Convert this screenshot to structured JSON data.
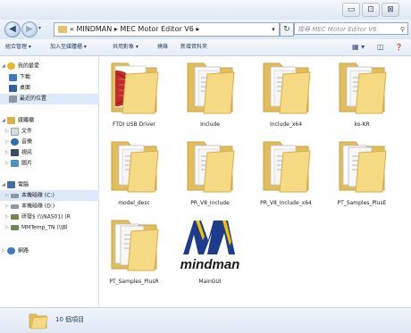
{
  "window": {
    "controls": {
      "minimize": "▭",
      "maximize": "⊡",
      "close": "⊠"
    }
  },
  "address": {
    "back": "◀",
    "forward": "▶",
    "segments": [
      "«",
      "MINDMAN",
      "▸",
      "MEC Motor Editor V6",
      "▸"
    ],
    "dropdown": "▾",
    "refresh": "↻",
    "search_placeholder": "搜尋 MEC Motor Editor V6",
    "search_icon": "⚲"
  },
  "toolbar": {
    "items": [
      "組合管理 ▾",
      "加入至媒體櫃 ▾",
      "共用對象 ▾",
      "燒錄",
      "新增資料夾"
    ],
    "view_icon": "▦ ▾",
    "preview_icon": "◫",
    "help_icon": "❓"
  },
  "sidebar": {
    "items": [
      {
        "label": "我的最愛",
        "icon": "star-icon",
        "color": "#e8b92f",
        "arrow": "◢"
      },
      {
        "label": "下載",
        "icon": "download-folder-icon",
        "color": "#3d7ac6",
        "arrow": ""
      },
      {
        "label": "桌面",
        "icon": "desktop-icon",
        "color": "#2d5fa8",
        "arrow": ""
      },
      {
        "label": "最近的位置",
        "icon": "recent-places-icon",
        "color": "#8c98a8",
        "arrow": ""
      },
      {
        "label": "媒體櫃",
        "icon": "library-icon",
        "color": "#d8b34a",
        "arrow": "◢"
      },
      {
        "label": "文件",
        "icon": "documents-icon",
        "color": "#d9dde3",
        "arrow": "▷"
      },
      {
        "label": "音樂",
        "icon": "music-icon",
        "color": "#2f6cb4",
        "arrow": "▷"
      },
      {
        "label": "視訊",
        "icon": "video-icon",
        "color": "#3a4b63",
        "arrow": "▷"
      },
      {
        "label": "圖片",
        "icon": "pictures-icon",
        "color": "#4d8fc7",
        "arrow": "▷"
      },
      {
        "label": "電腦",
        "icon": "computer-icon",
        "color": "#3f6ea8",
        "arrow": "◢"
      },
      {
        "label": "本機磁碟 (C:)",
        "icon": "drive-c-icon",
        "color": "#8b98a8",
        "arrow": "▷"
      },
      {
        "label": "本機磁碟 (D:)",
        "icon": "drive-d-icon",
        "color": "#8b98a8",
        "arrow": "▷"
      },
      {
        "label": "研發$ (\\\\NAS01) (R",
        "icon": "network-drive-icon",
        "color": "#6e8a52",
        "arrow": "▷"
      },
      {
        "label": "MMTemp_TN (\\\\Bl",
        "icon": "network-drive-icon",
        "color": "#6e8a52",
        "arrow": "▷"
      },
      {
        "label": "網路",
        "icon": "network-icon",
        "color": "#3b7ac4",
        "arrow": "▷"
      }
    ]
  },
  "files": [
    {
      "name": "FTDI USB Driver",
      "icon": "folder-ftdi-icon"
    },
    {
      "name": "Include",
      "icon": "folder-icon"
    },
    {
      "name": "Include_x64",
      "icon": "folder-icon"
    },
    {
      "name": "ko-KR",
      "icon": "folder-icon"
    },
    {
      "name": "model_desc",
      "icon": "folder-icon"
    },
    {
      "name": "PR_V8_Include",
      "icon": "folder-icon"
    },
    {
      "name": "PR_V8_Include_x64",
      "icon": "folder-icon"
    },
    {
      "name": "PT_Samples_PlusE",
      "icon": "folder-icon"
    },
    {
      "name": "PT_Samples_PlusR",
      "icon": "folder-icon"
    },
    {
      "name": "MainGUI",
      "icon": "mindman-app-icon",
      "logo_text": "mindman"
    }
  ],
  "status": {
    "count": "10 個項目"
  },
  "colors": {
    "folder_back": "#e8c567",
    "folder_front": "#f6dd8c",
    "selection": "#dce9f8",
    "brand_blue": "#1f3c8c",
    "brand_yellow": "#f0c400"
  }
}
